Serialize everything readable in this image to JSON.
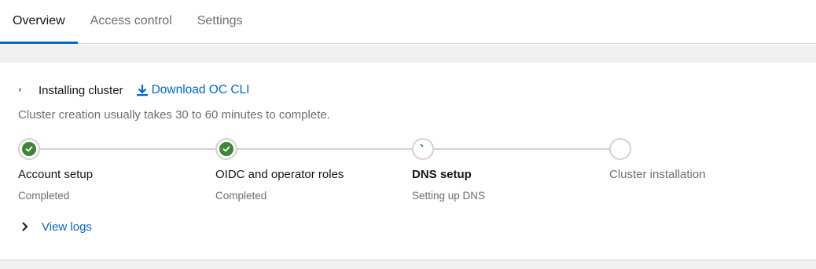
{
  "tabs": [
    {
      "label": "Overview",
      "active": true
    },
    {
      "label": "Access control",
      "active": false
    },
    {
      "label": "Settings",
      "active": false
    }
  ],
  "status": {
    "label": "Installing cluster",
    "spinner_icon": "spinner-icon"
  },
  "download": {
    "label": "Download OC CLI",
    "icon": "download-icon"
  },
  "subtitle": "Cluster creation usually takes 30 to 60 minutes to complete.",
  "steps": [
    {
      "title": "Account setup",
      "description": "Completed",
      "state": "completed"
    },
    {
      "title": "OIDC and operator roles",
      "description": "Completed",
      "state": "completed"
    },
    {
      "title": "DNS setup",
      "description": "Setting up DNS",
      "state": "in-progress"
    },
    {
      "title": "Cluster installation",
      "description": "",
      "state": "pending"
    }
  ],
  "logs": {
    "label": "View logs",
    "icon": "chevron-right-icon"
  },
  "colors": {
    "accent": "#0066cc",
    "success": "#3e8635",
    "muted": "#6a6e73",
    "border": "#d2d2d2"
  }
}
